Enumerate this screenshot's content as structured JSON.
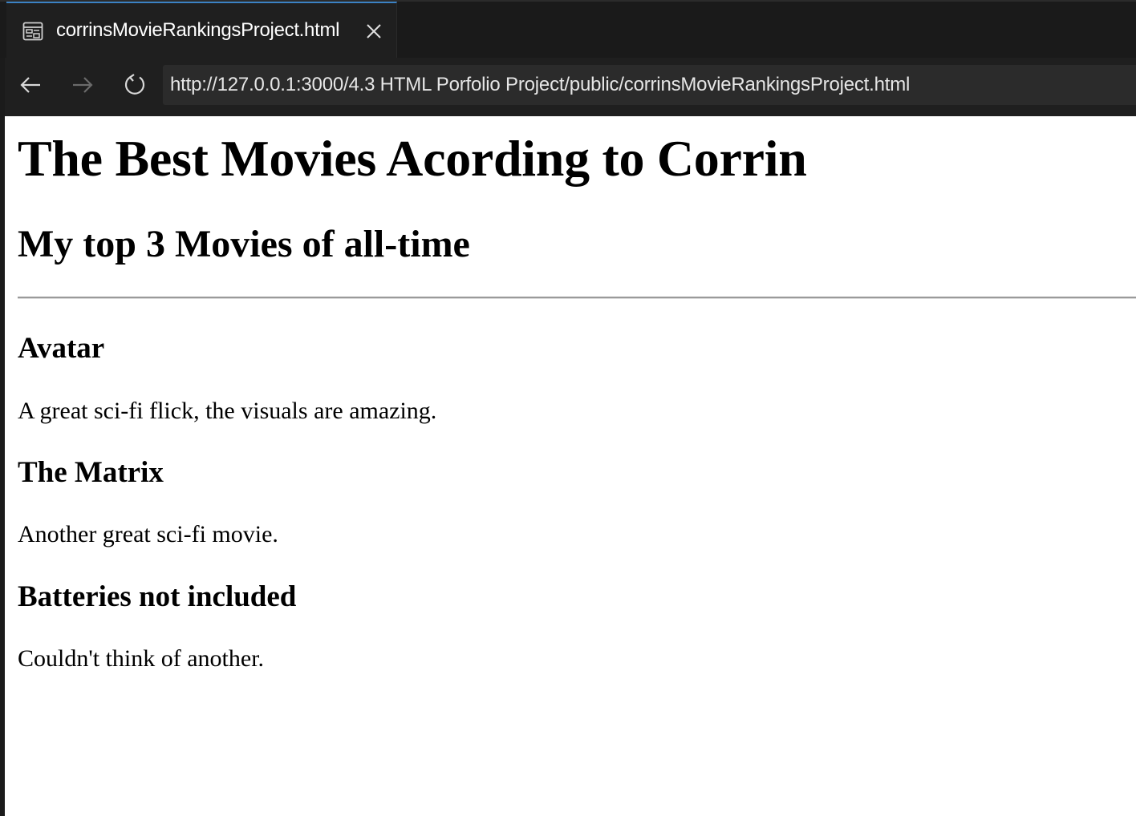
{
  "browser": {
    "tab": {
      "title": "corrinsMovieRankingsProject.html",
      "icon": "preview-page-icon",
      "close_icon": "close-icon"
    },
    "nav": {
      "back_icon": "arrow-left-icon",
      "forward_icon": "arrow-right-icon",
      "reload_icon": "reload-icon"
    },
    "address_bar": {
      "url": "http://127.0.0.1:3000/4.3 HTML Porfolio Project/public/corrinsMovieRankingsProject.html"
    },
    "colors": {
      "chrome_background": "#1f1f1f",
      "active_tab_accent": "#3b82c4",
      "url_box": "#2b2b2b"
    }
  },
  "page": {
    "heading": "The Best Movies Acording to Corrin",
    "subheading": "My top 3 Movies of all-time",
    "movies": [
      {
        "title": "Avatar",
        "description": "A great sci-fi flick, the visuals are amazing."
      },
      {
        "title": "The Matrix",
        "description": "Another great sci-fi movie."
      },
      {
        "title": "Batteries not included",
        "description": "Couldn't think of another."
      }
    ]
  }
}
